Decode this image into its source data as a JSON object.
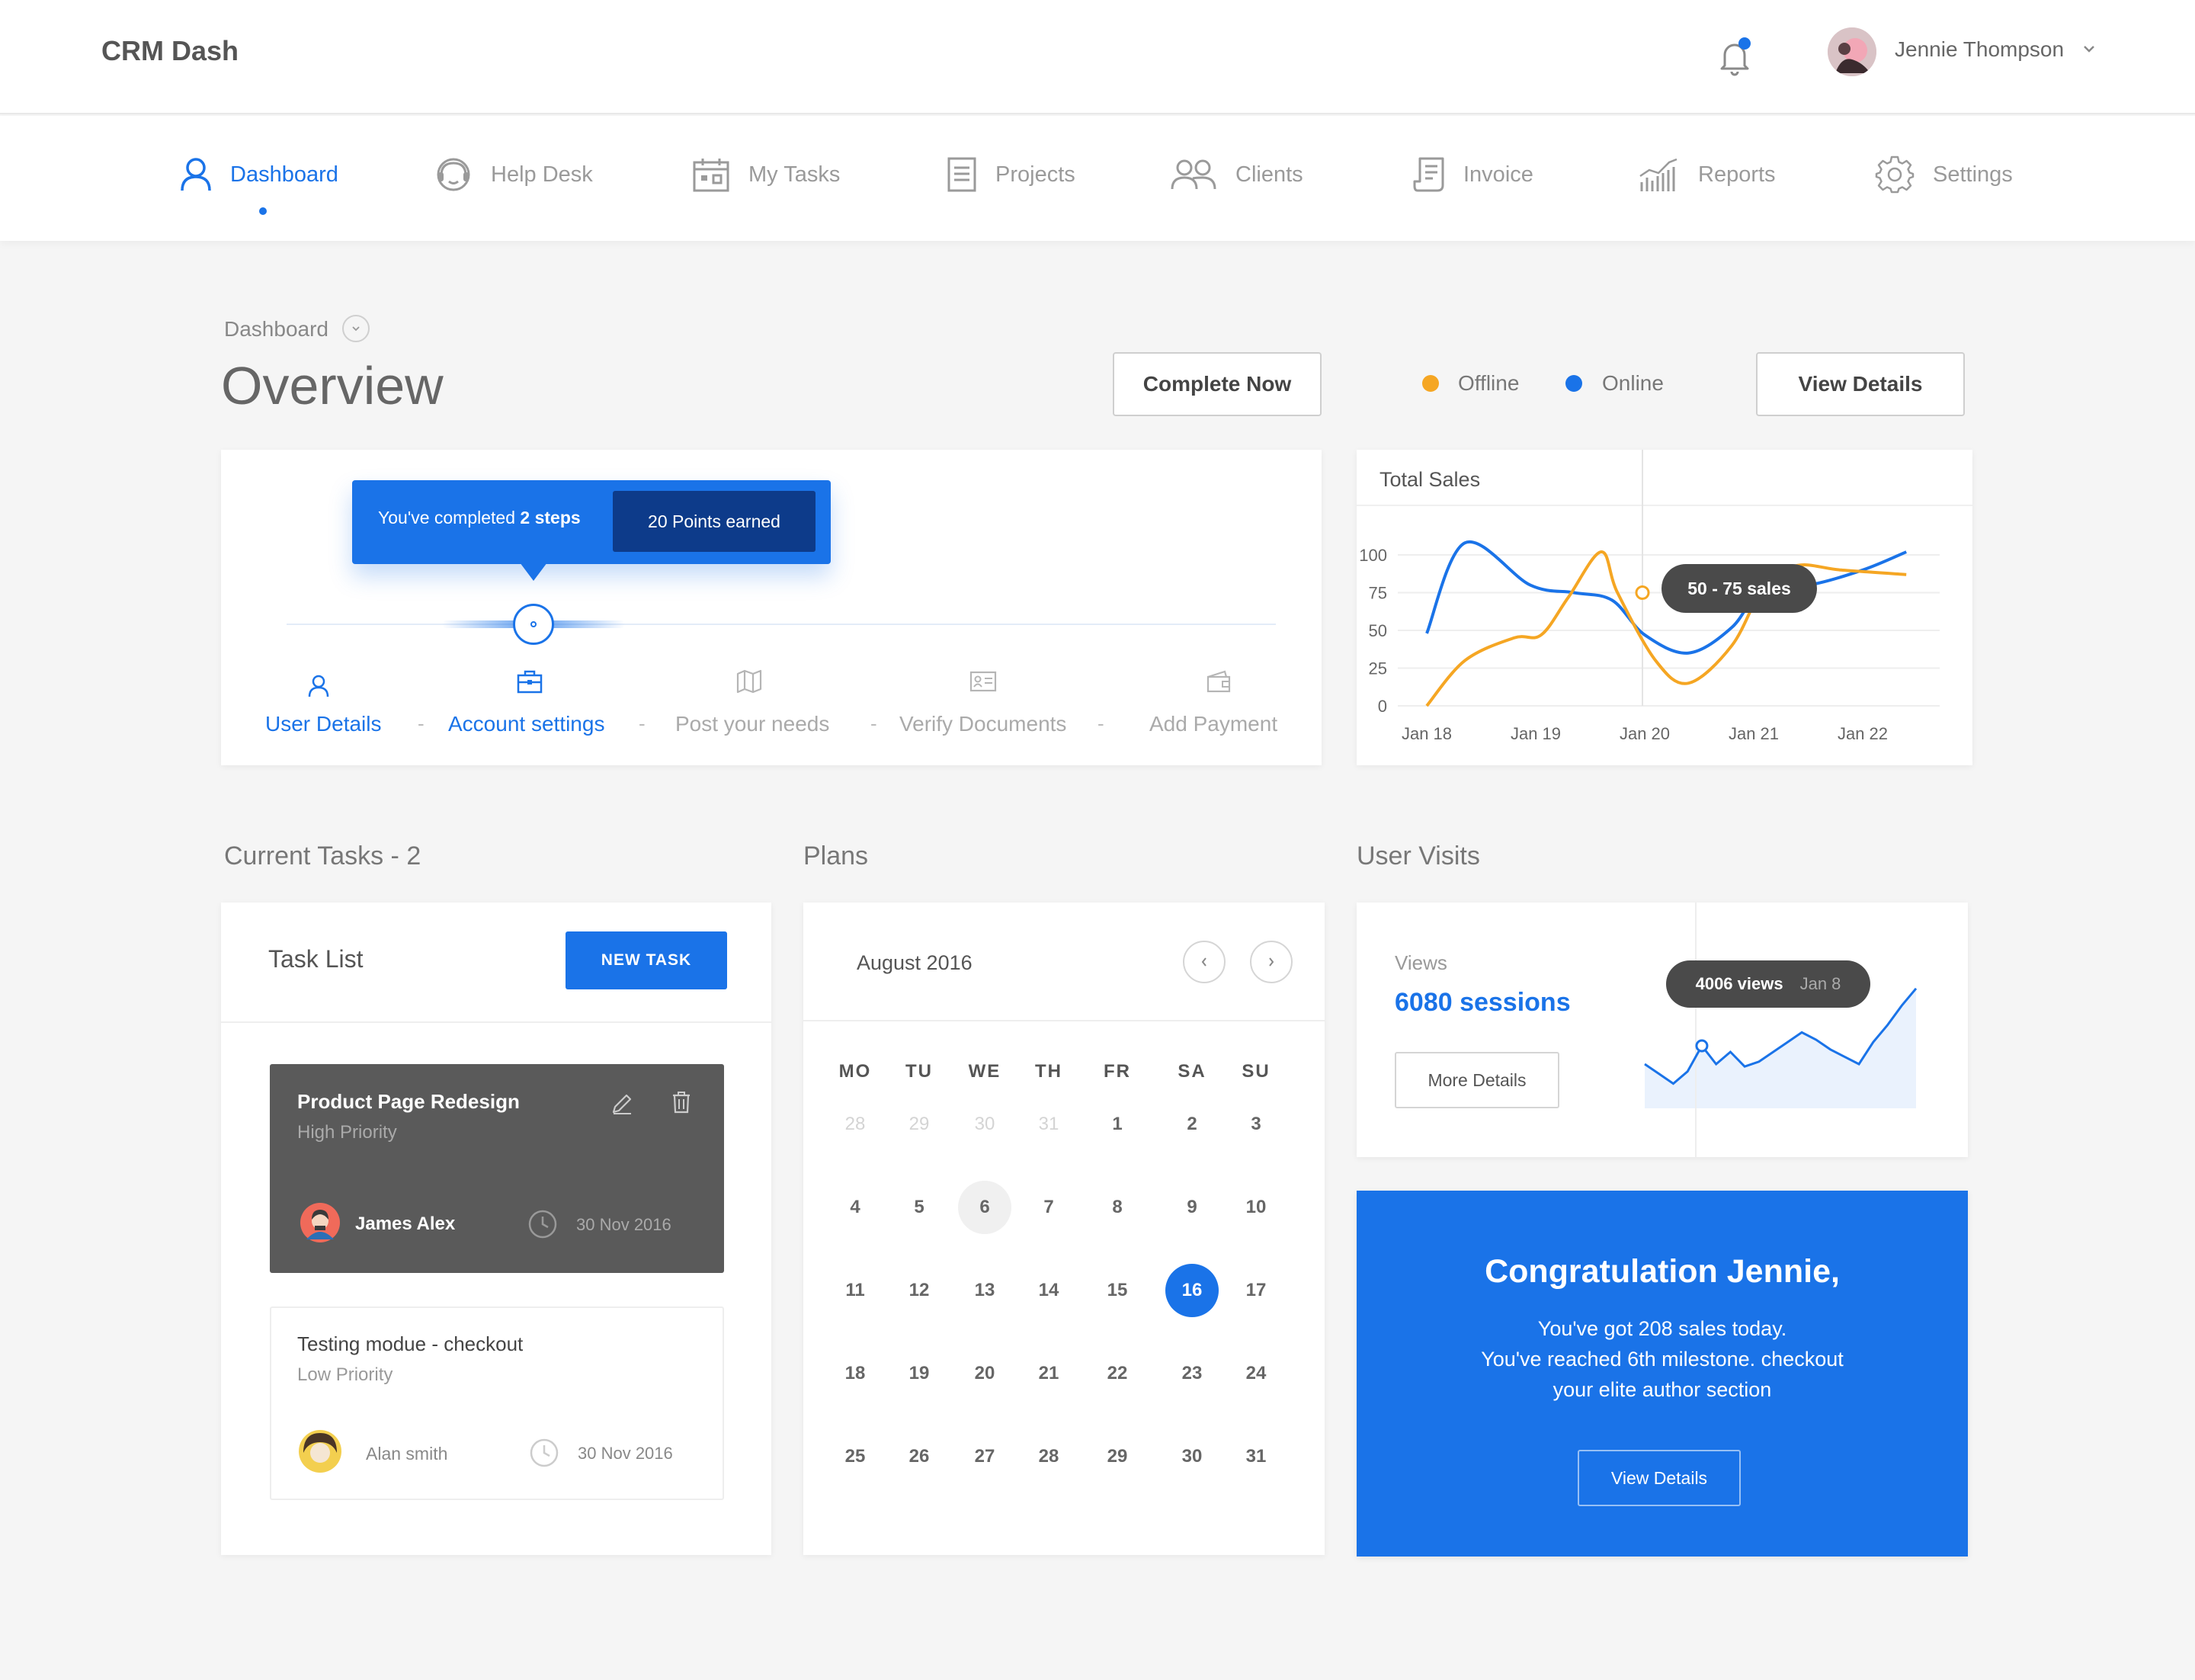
{
  "app": {
    "brand": "CRM Dash"
  },
  "user": {
    "name": "Jennie Thompson"
  },
  "nav": [
    {
      "label": "Dashboard",
      "icon": "user-icon",
      "active": true
    },
    {
      "label": "Help Desk",
      "icon": "headset-icon"
    },
    {
      "label": "My Tasks",
      "icon": "calendar-icon"
    },
    {
      "label": "Projects",
      "icon": "document-icon"
    },
    {
      "label": "Clients",
      "icon": "users-icon"
    },
    {
      "label": "Invoice",
      "icon": "receipt-icon"
    },
    {
      "label": "Reports",
      "icon": "bar-chart-icon"
    },
    {
      "label": "Settings",
      "icon": "gear-icon"
    }
  ],
  "page": {
    "breadcrumb": "Dashboard",
    "title": "Overview",
    "complete_now": "Complete Now",
    "view_details": "View Details"
  },
  "legend": {
    "offline": "Offline",
    "online": "Online",
    "offline_color": "#f5a623",
    "online_color": "#1a73e8"
  },
  "progress": {
    "tooltip_prefix": "You've completed ",
    "tooltip_bold": "2 steps",
    "points": "20 Points earned",
    "completed_steps": 2,
    "steps": [
      {
        "label": "User Details",
        "done": true
      },
      {
        "label": "Account settings",
        "done": true
      },
      {
        "label": "Post your needs",
        "done": false
      },
      {
        "label": "Verify Documents",
        "done": false
      },
      {
        "label": "Add Payment",
        "done": false
      }
    ],
    "separator": "-"
  },
  "sales": {
    "title": "Total Sales",
    "tooltip": "50 -  75 sales",
    "chart_data": {
      "type": "line",
      "title": "Total Sales",
      "x": [
        "Jan 18",
        "Jan 19",
        "Jan 20",
        "Jan 21",
        "Jan 22"
      ],
      "ylim": [
        0,
        100
      ],
      "yticks": [
        0,
        25,
        50,
        75,
        100
      ],
      "series": [
        {
          "name": "Online",
          "color": "#1a73e8",
          "points": [
            [
              0,
              48
            ],
            [
              0.35,
              108
            ],
            [
              0.95,
              80
            ],
            [
              1.35,
              75
            ],
            [
              1.7,
              70
            ],
            [
              2.0,
              47
            ],
            [
              2.4,
              35
            ],
            [
              2.8,
              52
            ],
            [
              3.1,
              80
            ],
            [
              3.5,
              80
            ],
            [
              4.0,
              90
            ],
            [
              4.4,
              102
            ]
          ]
        },
        {
          "name": "Offline",
          "color": "#f5a623",
          "points": [
            [
              0,
              0
            ],
            [
              0.35,
              30
            ],
            [
              0.8,
              45
            ],
            [
              1.05,
              47
            ],
            [
              1.3,
              72
            ],
            [
              1.6,
              102
            ],
            [
              1.75,
              75
            ],
            [
              2.1,
              30
            ],
            [
              2.4,
              15
            ],
            [
              2.8,
              40
            ],
            [
              3.1,
              80
            ],
            [
              3.4,
              93
            ],
            [
              3.8,
              90
            ],
            [
              4.4,
              87
            ]
          ]
        }
      ]
    }
  },
  "tasks": {
    "section": "Current Tasks - 2",
    "title": "Task List",
    "new_task": "NEW TASK",
    "items": [
      {
        "title": "Product Page Redesign",
        "priority": "High Priority",
        "assignee": "James Alex",
        "date": "30 Nov 2016"
      },
      {
        "title": "Testing modue - checkout",
        "priority": "Low Priority",
        "assignee": "Alan smith",
        "date": "30 Nov 2016"
      }
    ]
  },
  "plans": {
    "section": "Plans",
    "month": "August 2016",
    "weekdays": [
      "MO",
      "TU",
      "WE",
      "TH",
      "FR",
      "SA",
      "SU"
    ],
    "weeks": [
      [
        "28",
        "29",
        "30",
        "31",
        "1",
        "2",
        "3"
      ],
      [
        "4",
        "5",
        "6",
        "7",
        "8",
        "9",
        "10"
      ],
      [
        "11",
        "12",
        "13",
        "14",
        "15",
        "16",
        "17"
      ],
      [
        "18",
        "19",
        "20",
        "21",
        "22",
        "23",
        "24"
      ],
      [
        "25",
        "26",
        "27",
        "28",
        "29",
        "30",
        "31"
      ]
    ],
    "today": "6",
    "selected": "16"
  },
  "visits": {
    "section": "User Visits",
    "label": "Views",
    "sessions": "6080 sessions",
    "more": "More Details",
    "tooltip_views": "4006 views",
    "tooltip_date": "Jan 8",
    "chart_data": {
      "type": "area",
      "values": [
        30,
        22,
        14,
        24,
        45,
        30,
        40,
        28,
        32,
        40,
        48,
        56,
        50,
        42,
        36,
        30,
        48,
        62,
        78,
        92
      ]
    }
  },
  "congrats": {
    "title": "Congratulation Jennie,",
    "line1": "You've got 208 sales today.",
    "line2": "You've reached 6th milestone. checkout",
    "line3": "your elite author section",
    "button": "View Details"
  }
}
